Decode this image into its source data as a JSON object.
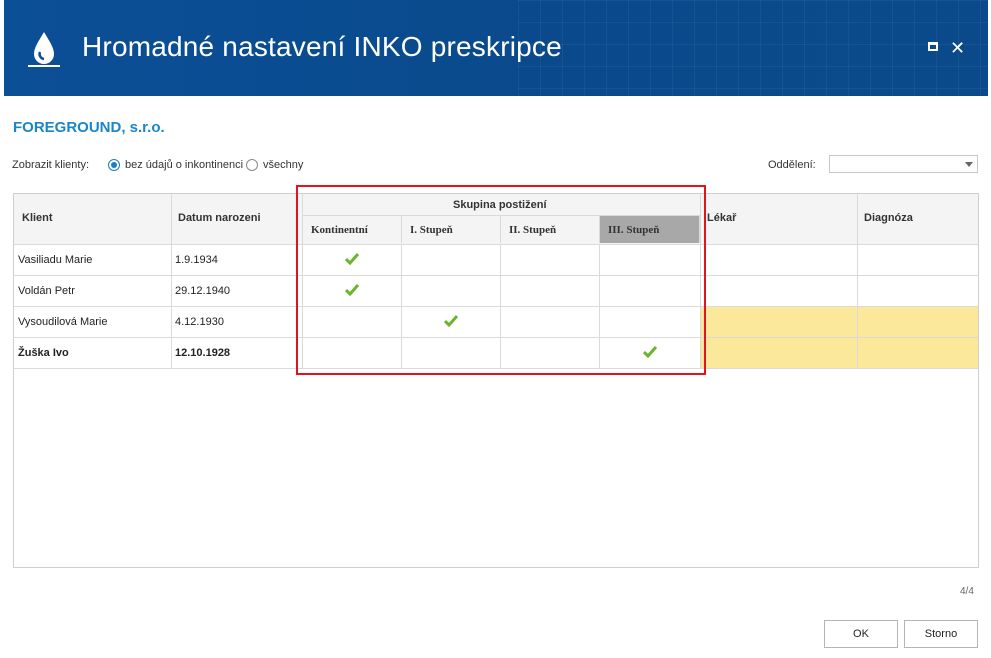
{
  "window": {
    "title": "Hromadné nastavení INKO preskripce",
    "icon": "water-drop-icon"
  },
  "company": "FOREGROUND, s.r.o.",
  "filter": {
    "label": "Zobrazit klienty:",
    "options": [
      "bez údajů o inkontinenci",
      "všechny"
    ],
    "selected": "bez údajů o inkontinenci"
  },
  "department": {
    "label": "Oddělení:",
    "value": ""
  },
  "grid": {
    "columns": {
      "client": "Klient",
      "birth": "Datum narozeni",
      "group": "Skupina postižení",
      "group_sub": [
        "Kontinentní",
        "I. Stupeň",
        "II. Stupeň",
        "III. Stupeň"
      ],
      "doctor": "Lékař",
      "diagnosis": "Diagnóza"
    },
    "rows": [
      {
        "client": "Vasiliadu Marie",
        "birth": "1.9.1934",
        "group": "Kontinentní",
        "yellow": false
      },
      {
        "client": "Voldán Petr",
        "birth": "29.12.1940",
        "group": "Kontinentní",
        "yellow": false
      },
      {
        "client": "Vysoudilová Marie",
        "birth": "4.12.1930",
        "group": "I. Stupeň",
        "yellow": true
      },
      {
        "client": "Žuška Ivo",
        "birth": "12.10.1928",
        "group": "III. Stupeň",
        "yellow": true
      }
    ]
  },
  "pager": "4/4",
  "buttons": {
    "ok": "OK",
    "cancel": "Storno"
  },
  "colors": {
    "titlebar": "#0b4f96",
    "accent": "#1a86c8",
    "check": "#6cb42c",
    "highlight": "#fbe89a",
    "annotation": "#e0141c"
  }
}
